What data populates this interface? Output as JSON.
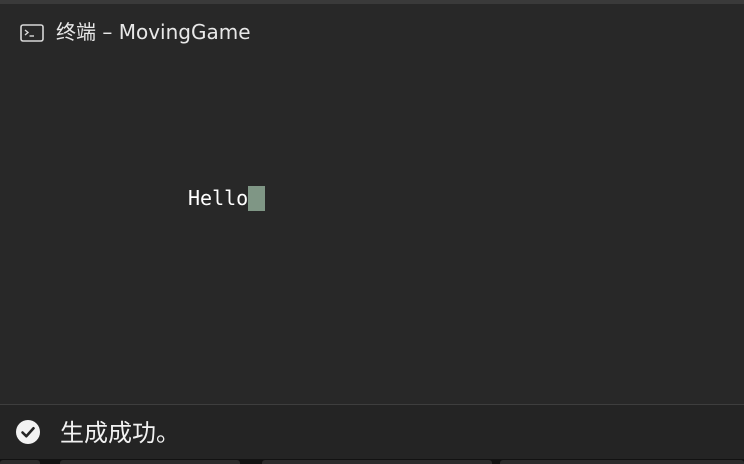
{
  "window": {
    "title": "终端 – MovingGame",
    "icon": "terminal-icon"
  },
  "terminal": {
    "output": "Hello",
    "cursor_color": "#7f9685"
  },
  "status": {
    "message": "生成成功。",
    "icon": "checkmark-circle-icon"
  }
}
